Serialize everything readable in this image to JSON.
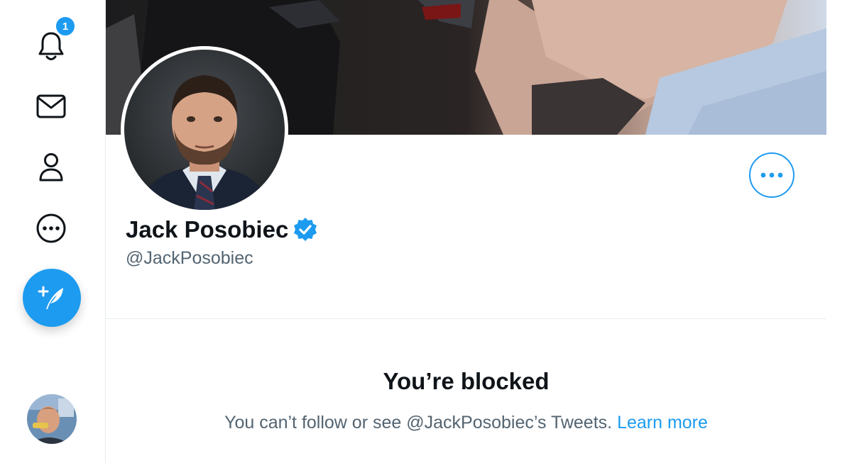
{
  "nav": {
    "notifications_count": "1",
    "icons": [
      "bell-icon",
      "mail-icon",
      "person-icon",
      "more-circle-icon",
      "compose-icon"
    ]
  },
  "profile": {
    "name": "Jack Posobiec",
    "handle": "@JackPosobiec",
    "verified": true
  },
  "blocked": {
    "title": "You’re blocked",
    "message": "You can’t follow or see @JackPosobiec’s Tweets. ",
    "learn_more": "Learn more"
  },
  "colors": {
    "accent": "#1d9bf0",
    "text": "#0f1419",
    "secondary": "#536471",
    "border": "#e6ecf0"
  }
}
